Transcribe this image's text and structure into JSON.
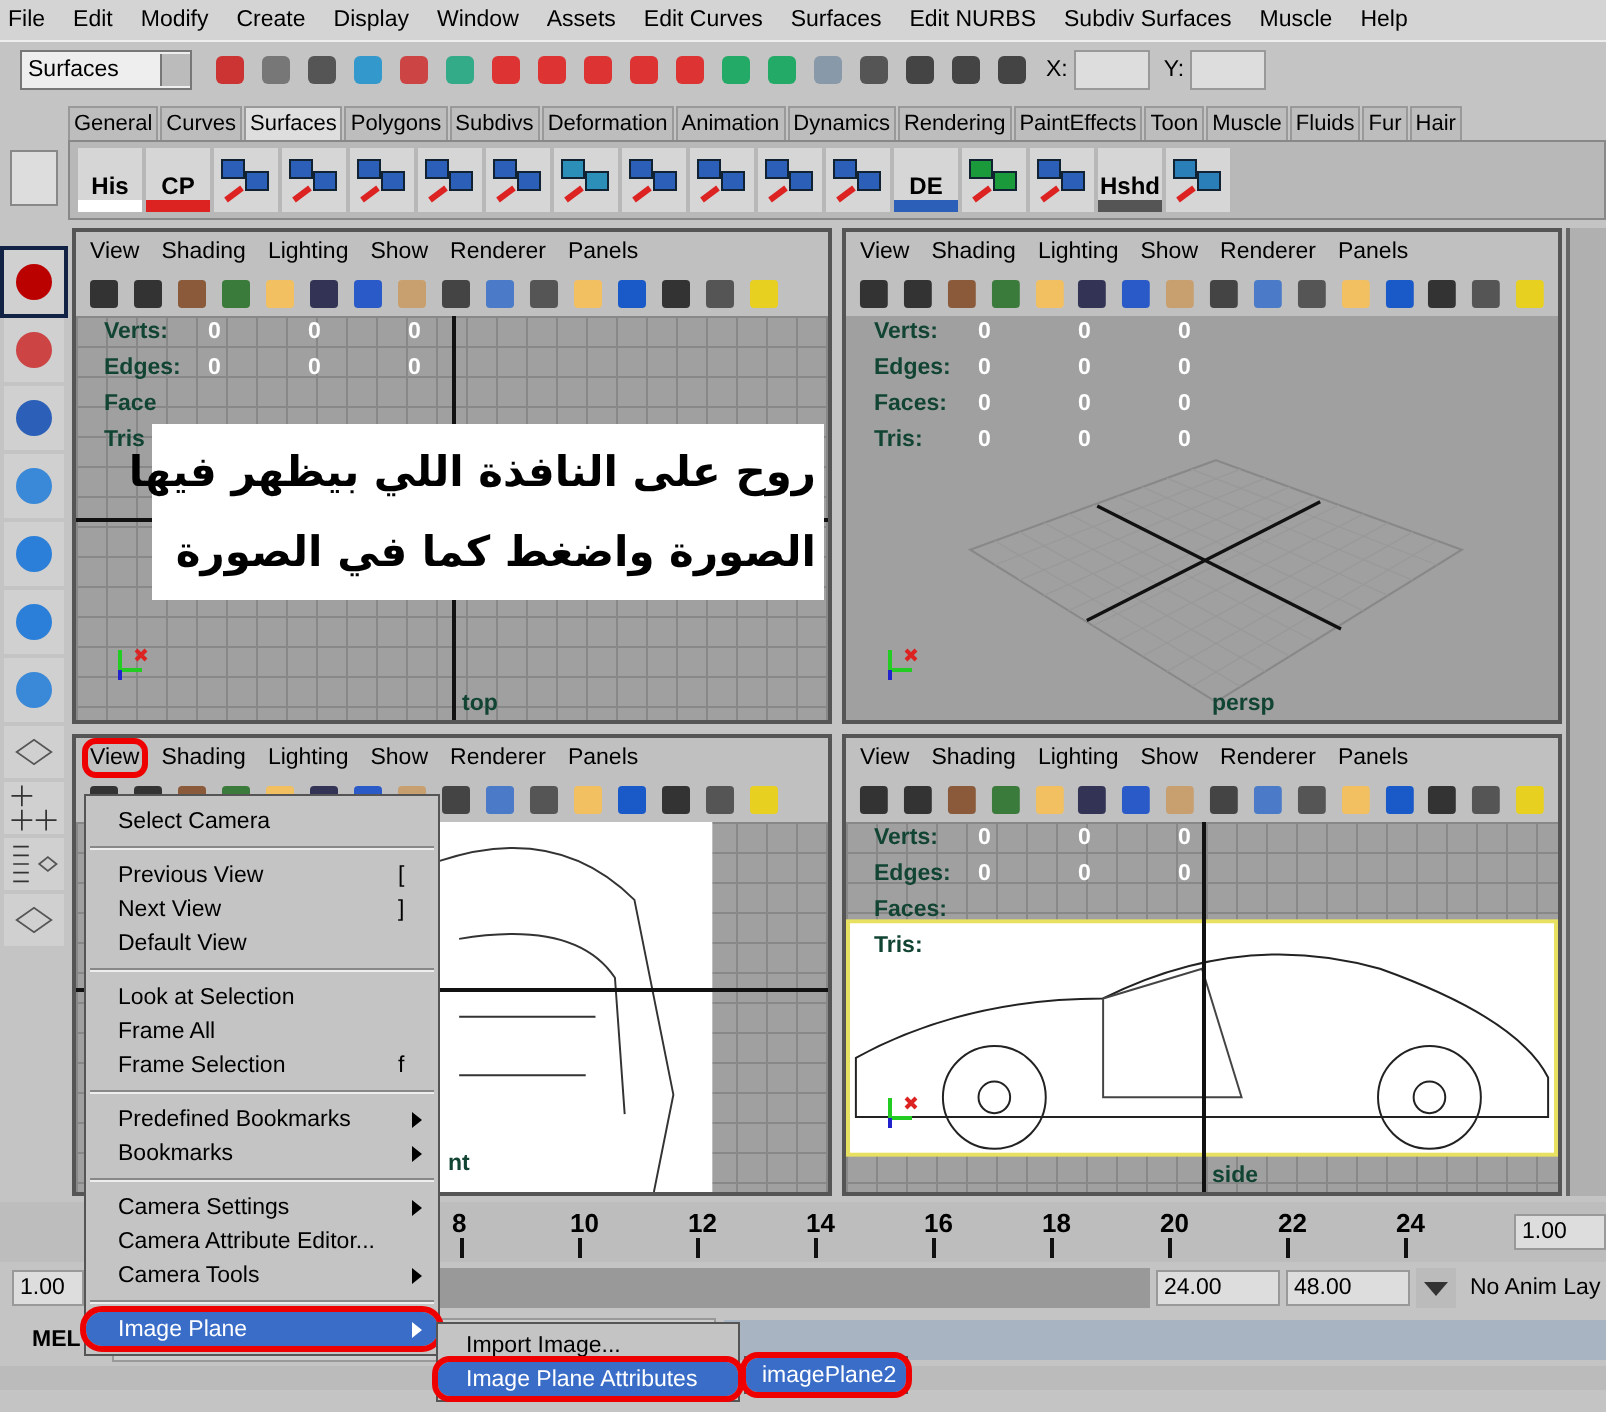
{
  "menu_bar": [
    "File",
    "Edit",
    "Modify",
    "Create",
    "Display",
    "Window",
    "Assets",
    "Edit Curves",
    "Surfaces",
    "Edit NURBS",
    "Subdiv Surfaces",
    "Muscle",
    "Help"
  ],
  "status_line": {
    "mode": "Surfaces",
    "x_label": "X:",
    "y_label": "Y:"
  },
  "shelf_tabs": [
    {
      "label": "General",
      "selected": false
    },
    {
      "label": "Curves",
      "selected": false
    },
    {
      "label": "Surfaces",
      "selected": true
    },
    {
      "label": "Polygons",
      "selected": false
    },
    {
      "label": "Subdivs",
      "selected": false
    },
    {
      "label": "Deformation",
      "selected": false
    },
    {
      "label": "Animation",
      "selected": false
    },
    {
      "label": "Dynamics",
      "selected": false
    },
    {
      "label": "Rendering",
      "selected": false
    },
    {
      "label": "PaintEffects",
      "selected": false
    },
    {
      "label": "Toon",
      "selected": false
    },
    {
      "label": "Muscle",
      "selected": false
    },
    {
      "label": "Fluids",
      "selected": false
    },
    {
      "label": "Fur",
      "selected": false
    },
    {
      "label": "Hair",
      "selected": false
    }
  ],
  "shelf": [
    {
      "kind": "labeled",
      "label": "His"
    },
    {
      "kind": "labeled",
      "label": "CP"
    },
    {
      "kind": "icon"
    },
    {
      "kind": "icon"
    },
    {
      "kind": "icon"
    },
    {
      "kind": "icon"
    },
    {
      "kind": "icon"
    },
    {
      "kind": "icon"
    },
    {
      "kind": "icon"
    },
    {
      "kind": "icon"
    },
    {
      "kind": "icon"
    },
    {
      "kind": "icon"
    },
    {
      "kind": "labeled",
      "label": "DE"
    },
    {
      "kind": "icon"
    },
    {
      "kind": "icon"
    },
    {
      "kind": "labeled",
      "label": "Hshd"
    },
    {
      "kind": "icon"
    }
  ],
  "viewports": [
    {
      "kind": "top",
      "camera": "top",
      "menus": [
        {
          "label": "View",
          "circled": false
        },
        {
          "label": "Shading",
          "circled": false
        },
        {
          "label": "Lighting",
          "circled": false
        },
        {
          "label": "Show",
          "circled": false
        },
        {
          "label": "Renderer",
          "circled": false
        },
        {
          "label": "Panels",
          "circled": false
        }
      ],
      "hud": [
        {
          "label": "Verts:",
          "values": [
            "0",
            "0",
            "0"
          ]
        },
        {
          "label": "Edges:",
          "values": [
            "0",
            "0",
            "0"
          ]
        },
        {
          "label": "Face"
        },
        {
          "label": "Tris"
        }
      ],
      "note": [
        "روح على النافذة اللي بيظهر فيها",
        "الصورة واضغط كما في الصورة"
      ]
    },
    {
      "kind": "persp",
      "camera": "persp",
      "menus": [
        {
          "label": "View",
          "circled": false
        },
        {
          "label": "Shading",
          "circled": false
        },
        {
          "label": "Lighting",
          "circled": false
        },
        {
          "label": "Show",
          "circled": false
        },
        {
          "label": "Renderer",
          "circled": false
        },
        {
          "label": "Panels",
          "circled": false
        }
      ],
      "hud": [
        {
          "label": "Verts:",
          "values": [
            "0",
            "0",
            "0"
          ]
        },
        {
          "label": "Edges:",
          "values": [
            "0",
            "0",
            "0"
          ]
        },
        {
          "label": "Faces:",
          "values": [
            "0",
            "0",
            "0"
          ]
        },
        {
          "label": "Tris:",
          "values": [
            "0",
            "0",
            "0"
          ]
        }
      ]
    },
    {
      "kind": "front",
      "camera": "nt",
      "menus": [
        {
          "label": "View",
          "circled": true
        },
        {
          "label": "Shading",
          "circled": false
        },
        {
          "label": "Lighting",
          "circled": false
        },
        {
          "label": "Show",
          "circled": false
        },
        {
          "label": "Renderer",
          "circled": false
        },
        {
          "label": "Panels",
          "circled": false
        }
      ]
    },
    {
      "kind": "side",
      "camera": "side",
      "menus": [
        {
          "label": "View",
          "circled": false
        },
        {
          "label": "Shading",
          "circled": false
        },
        {
          "label": "Lighting",
          "circled": false
        },
        {
          "label": "Show",
          "circled": false
        },
        {
          "label": "Renderer",
          "circled": false
        },
        {
          "label": "Panels",
          "circled": false
        }
      ],
      "hud": [
        {
          "label": "Verts:",
          "values": [
            "0",
            "0",
            "0"
          ]
        },
        {
          "label": "Edges:",
          "values": [
            "0",
            "0",
            "0"
          ]
        },
        {
          "label": "Faces:"
        },
        {
          "label": "Tris:"
        }
      ]
    }
  ],
  "timeline": {
    "ticks": [
      "8",
      "10",
      "12",
      "14",
      "16",
      "18",
      "20",
      "22",
      "24"
    ],
    "current": "1.00"
  },
  "range": {
    "level": 1,
    "start": "1.00",
    "end": "24.00",
    "max": "48.00",
    "layer": "No Anim Lay"
  },
  "command": {
    "label": "MEL"
  },
  "view_menu": [
    {
      "kind": "item",
      "label": "Select Camera",
      "submenu": false,
      "selected": false,
      "circled": false
    },
    {
      "kind": "separator"
    },
    {
      "kind": "item",
      "label": "Previous View",
      "shortcut": "[",
      "submenu": false,
      "selected": false,
      "circled": false
    },
    {
      "kind": "item",
      "label": "Next View",
      "shortcut": "]",
      "submenu": false,
      "selected": false,
      "circled": false
    },
    {
      "kind": "item",
      "label": "Default View",
      "submenu": false,
      "selected": false,
      "circled": false
    },
    {
      "kind": "separator"
    },
    {
      "kind": "item",
      "label": "Look at Selection",
      "submenu": false,
      "selected": false,
      "circled": false
    },
    {
      "kind": "item",
      "label": "Frame All",
      "submenu": false,
      "selected": false,
      "circled": false
    },
    {
      "kind": "item",
      "label": "Frame Selection",
      "shortcut": "f",
      "submenu": false,
      "selected": false,
      "circled": false
    },
    {
      "kind": "separator"
    },
    {
      "kind": "item",
      "label": "Predefined Bookmarks",
      "submenu": true,
      "selected": false,
      "circled": false
    },
    {
      "kind": "item",
      "label": "Bookmarks",
      "submenu": true,
      "selected": false,
      "circled": false
    },
    {
      "kind": "separator"
    },
    {
      "kind": "item",
      "label": "Camera Settings",
      "submenu": true,
      "selected": false,
      "circled": false
    },
    {
      "kind": "item",
      "label": "Camera Attribute Editor...",
      "submenu": false,
      "selected": false,
      "circled": false
    },
    {
      "kind": "item",
      "label": "Camera Tools",
      "submenu": true,
      "selected": false,
      "circled": false
    },
    {
      "kind": "separator"
    },
    {
      "kind": "item",
      "label": "Image Plane",
      "submenu": true,
      "selected": true,
      "circled": true
    }
  ],
  "image_plane_menu": [
    {
      "label": "Import Image...",
      "selected": false,
      "circled": false
    },
    {
      "label": "Image Plane Attributes",
      "selected": true,
      "circled": true
    }
  ],
  "image_plane_list": [
    {
      "label": "imagePlane2",
      "selected": true,
      "circled": true
    }
  ]
}
